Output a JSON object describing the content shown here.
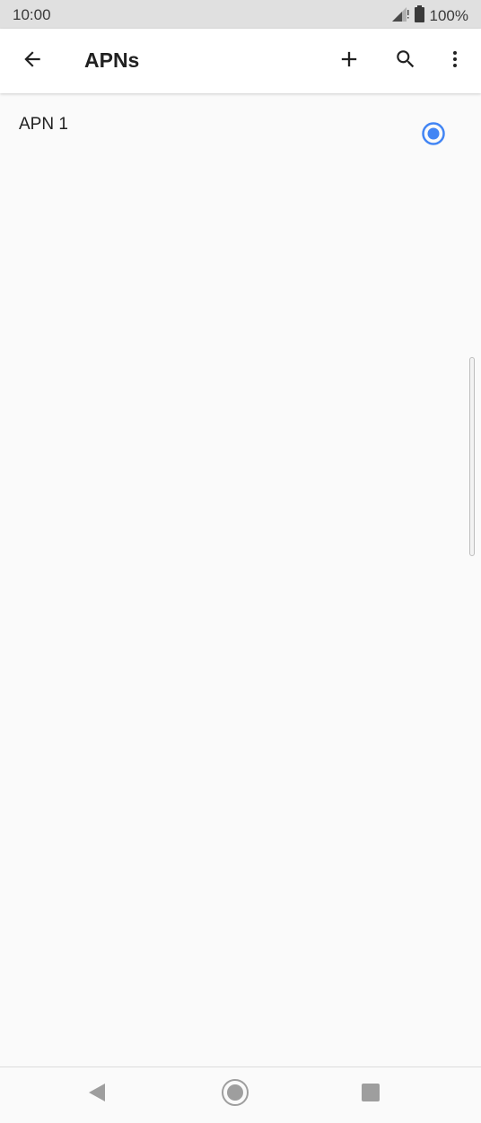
{
  "status_bar": {
    "time": "10:00",
    "battery_text": "100%",
    "icons": [
      "signal-icon",
      "battery-icon"
    ]
  },
  "app_bar": {
    "title": "APNs",
    "icons": [
      "back-arrow-icon",
      "plus-icon",
      "search-icon",
      "more-vert-icon"
    ]
  },
  "apn_list": {
    "items": [
      {
        "name": "APN 1",
        "selected": true
      }
    ]
  },
  "colors": {
    "accent": "#4285f4",
    "status_bar_bg": "#e0e0e0",
    "app_bar_bg": "#ffffff",
    "content_bg": "#fafafa"
  },
  "nav_bar": {
    "icons": [
      "nav-back-icon",
      "nav-home-icon",
      "nav-recents-icon"
    ]
  }
}
